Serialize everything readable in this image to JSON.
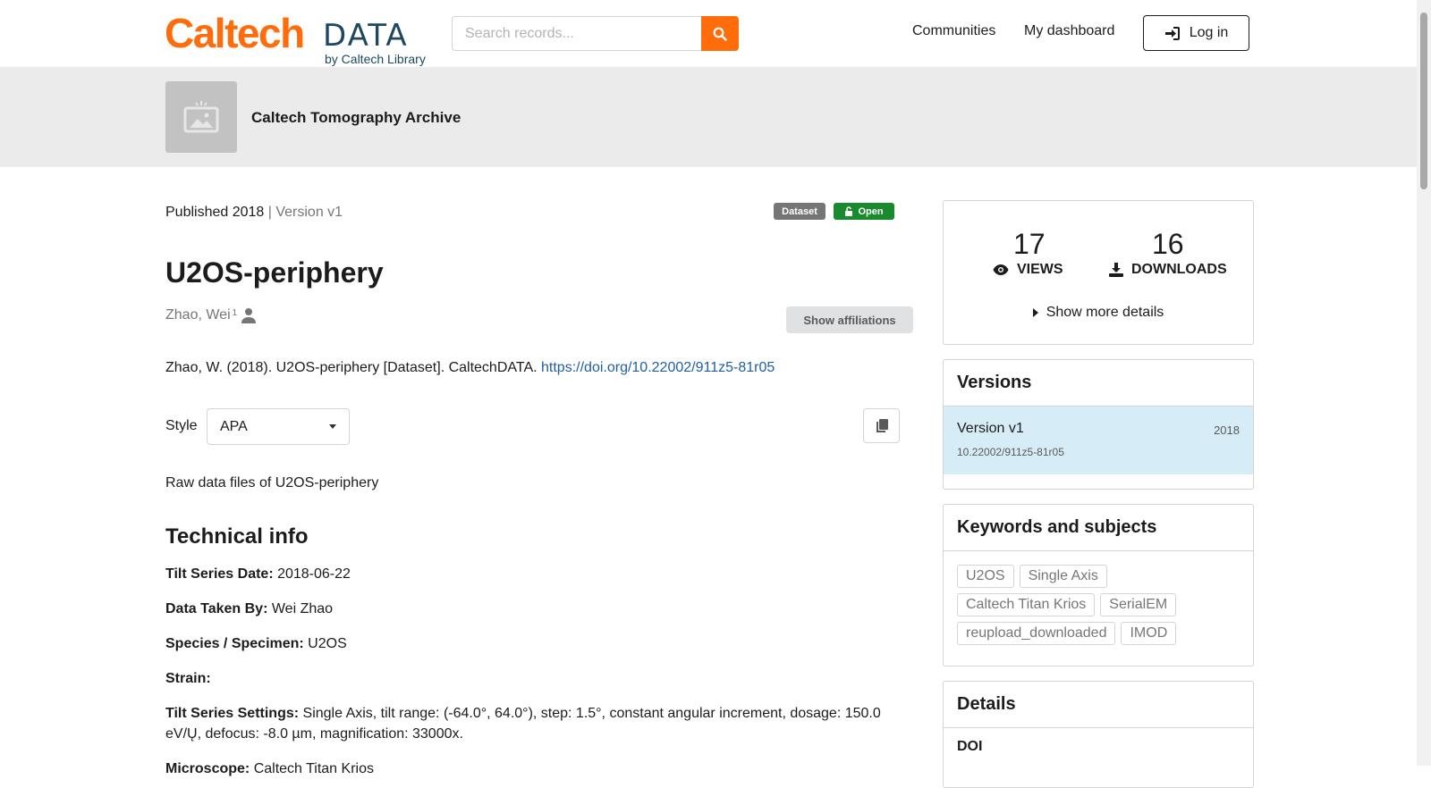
{
  "header": {
    "logo_main": "Caltech",
    "logo_data": "DATA",
    "logo_sub": "by Caltech Library",
    "search_placeholder": "Search records...",
    "nav": [
      "Communities",
      "My dashboard"
    ],
    "login_label": "Log in"
  },
  "community": {
    "name": "Caltech Tomography Archive"
  },
  "record": {
    "published": "Published 2018",
    "version_sep": " | ",
    "version": "Version v1",
    "badges": {
      "type": "Dataset",
      "access": "Open"
    },
    "title": "U2OS-periphery",
    "creator": "Zhao, Wei",
    "creator_sup": "1",
    "show_affiliations": "Show affiliations",
    "citation_text": "Zhao, W. (2018). U2OS-periphery [Dataset]. CaltechDATA. ",
    "citation_link": "https://doi.org/10.22002/911z5-81r05",
    "style_label": "Style",
    "style_value": "APA",
    "description": "Raw data files of U2OS-periphery",
    "technical_heading": "Technical info",
    "technical": [
      {
        "label": "Tilt Series Date:",
        "value": " 2018-06-22"
      },
      {
        "label": "Data Taken By:",
        "value": " Wei Zhao"
      },
      {
        "label": "Species / Specimen:",
        "value": " U2OS"
      },
      {
        "label": "Strain:",
        "value": ""
      },
      {
        "label": "Tilt Series Settings:",
        "value": " Single Axis, tilt range: (-64.0°, 64.0°), step: 1.5°, constant angular increment, dosage: 150.0 eV/Ų, defocus: -8.0 µm, magnification: 33000x."
      },
      {
        "label": "Microscope:",
        "value": " Caltech Titan Krios"
      }
    ]
  },
  "sidebar": {
    "views_count": "17",
    "views_label": "VIEWS",
    "downloads_count": "16",
    "downloads_label": "DOWNLOADS",
    "more_details": "Show more details",
    "versions_heading": "Versions",
    "version_item": {
      "name": "Version v1",
      "year": "2018",
      "doi": "10.22002/911z5-81r05"
    },
    "keywords_heading": "Keywords and subjects",
    "keywords": [
      "U2OS",
      "Single Axis",
      "Caltech Titan Krios",
      "SerialEM",
      "reupload_downloaded",
      "IMOD"
    ],
    "details_heading": "Details",
    "doi_label": "DOI"
  },
  "colors": {
    "brand_orange": "#ff6c0c",
    "open_green": "#1a8a2e",
    "link_blue": "#1f5ea8",
    "version_bg": "#d6ecf6"
  },
  "icons": [
    "search-icon",
    "login-icon",
    "image-placeholder-icon",
    "lock-open-icon",
    "user-icon",
    "copy-icon",
    "eye-icon",
    "download-icon",
    "caret-right-icon"
  ]
}
